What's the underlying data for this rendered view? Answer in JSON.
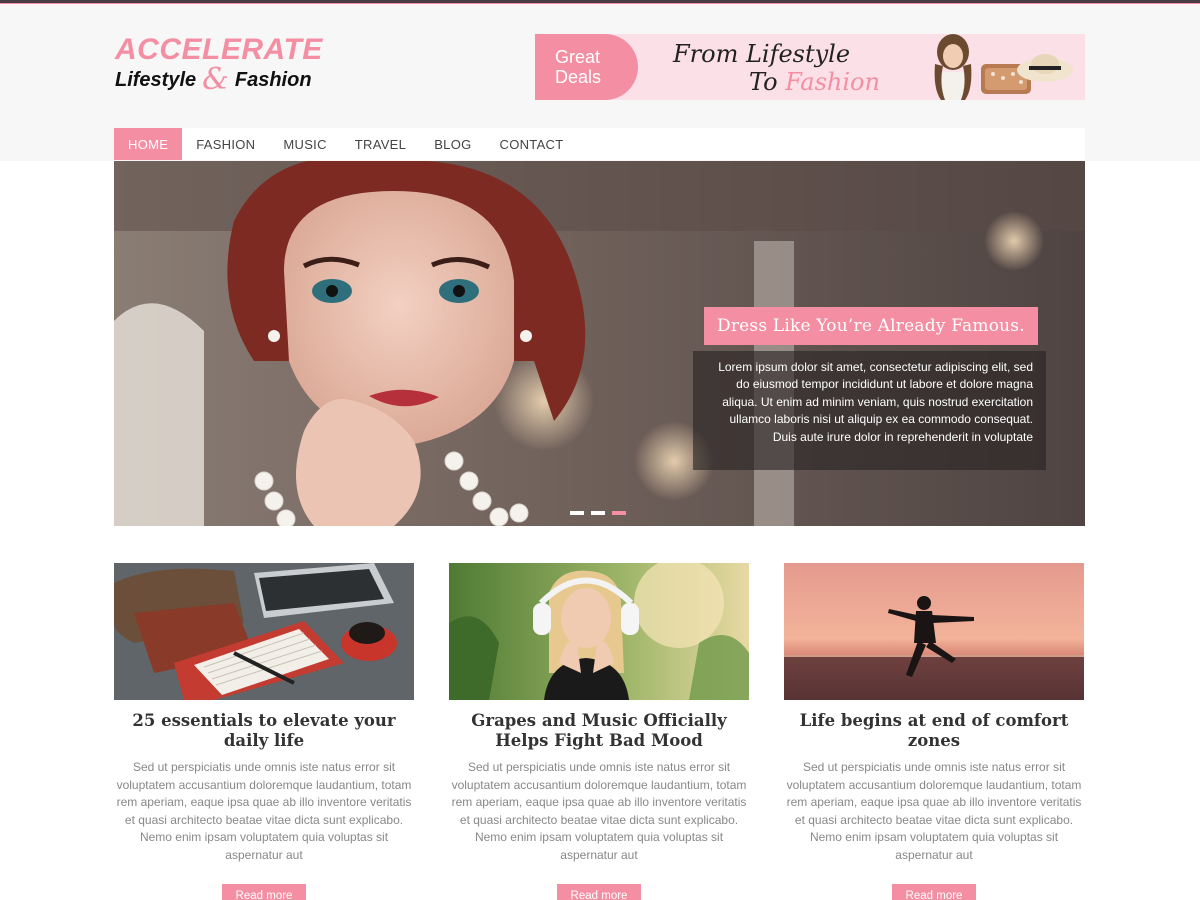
{
  "colors": {
    "accent": "#f48fa3",
    "header_bg": "#f7f7f7",
    "text_dark": "#333333",
    "text_muted": "#888888"
  },
  "logo": {
    "title": "ACCELERATE",
    "tag_left": "Lifestyle",
    "tag_amp": "&",
    "tag_right": "Fashion"
  },
  "ad_banner": {
    "tab_line1": "Great",
    "tab_line2": "Deals",
    "headline_line1": "From Lifestyle",
    "headline_to": "To",
    "headline_fashion": "Fashion"
  },
  "nav": {
    "items": [
      {
        "label": "HOME",
        "active": true
      },
      {
        "label": "FASHION",
        "active": false
      },
      {
        "label": "MUSIC",
        "active": false
      },
      {
        "label": "TRAVEL",
        "active": false
      },
      {
        "label": "BLOG",
        "active": false
      },
      {
        "label": "CONTACT",
        "active": false
      }
    ]
  },
  "slider": {
    "caption_title": "Dress Like You’re Already Famous.",
    "caption_body": "Lorem ipsum dolor sit amet, consectetur adipiscing elit, sed do eiusmod tempor incididunt ut labore et dolore magna aliqua. Ut enim ad minim veniam, quis nostrud exercitation ullamco laboris nisi ut aliquip ex ea commodo consequat. Duis aute irure dolor in reprehenderit in voluptate",
    "slide_count": 3,
    "active_slide": 3
  },
  "posts": [
    {
      "title": "25 essentials to elevate your daily life",
      "excerpt": "Sed ut perspiciatis unde omnis iste natus error sit voluptatem accusantium doloremque laudantium, totam rem aperiam, eaque ipsa quae ab illo inventore veritatis et quasi architecto beatae vitae dicta sunt explicabo. Nemo enim ipsam voluptatem quia voluptas sit aspernatur aut",
      "read_more": "Read more",
      "image": "desk-flatlay"
    },
    {
      "title": "Grapes and Music Officially Helps Fight Bad Mood",
      "excerpt": "Sed ut perspiciatis unde omnis iste natus error sit voluptatem accusantium doloremque laudantium, totam rem aperiam, eaque ipsa quae ab illo inventore veritatis et quasi architecto beatae vitae dicta sunt explicabo. Nemo enim ipsam voluptatem quia voluptas sit aspernatur aut",
      "read_more": "Read more",
      "image": "woman-headphones"
    },
    {
      "title": "Life begins at end of comfort zones",
      "excerpt": "Sed ut perspiciatis unde omnis iste natus error sit voluptatem accusantium doloremque laudantium, totam rem aperiam, eaque ipsa quae ab illo inventore veritatis et quasi architecto beatae vitae dicta sunt explicabo. Nemo enim ipsam voluptatem quia voluptas sit aspernatur aut",
      "read_more": "Read more",
      "image": "sunset-jump"
    }
  ]
}
